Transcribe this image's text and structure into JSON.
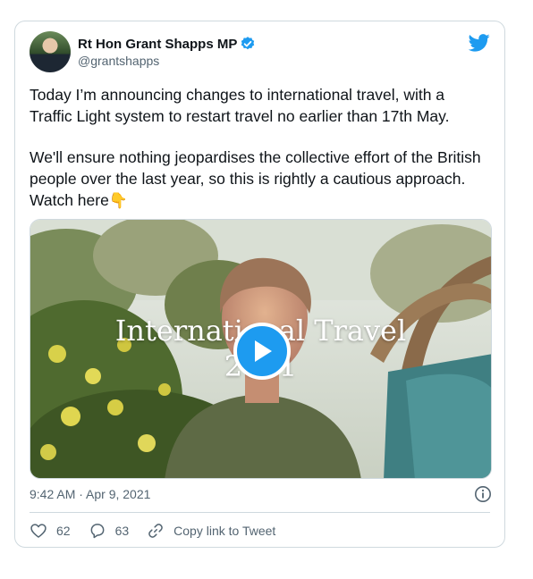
{
  "tweet": {
    "author": {
      "display_name": "Rt Hon Grant Shapps MP",
      "handle": "@grantshapps",
      "verified": true
    },
    "text_paragraphs": [
      "Today I’m announcing changes to international travel, with a Traffic Light system to restart travel no earlier than 17th May.",
      "We'll ensure nothing jeopardises the collective effort of the British people over the last year, so this is rightly a cautious approach. Watch here"
    ],
    "emoji": "👇",
    "media": {
      "type": "video",
      "title_line1": "International Travel",
      "title_line2": "2021"
    },
    "timestamp": "9:42 AM · Apr 9, 2021",
    "actions": {
      "likes": "62",
      "replies": "63",
      "copy_link_label": "Copy link to Tweet"
    }
  },
  "icons": {
    "brand": "twitter-bird-icon",
    "verified": "verified-badge-icon",
    "play": "play-icon",
    "info": "info-icon",
    "like": "heart-icon",
    "reply": "reply-bubble-icon",
    "link": "link-icon"
  },
  "colors": {
    "accent": "#1d9bf0",
    "text": "#0f1419",
    "secondary": "#536471",
    "border": "#cfd9de"
  }
}
